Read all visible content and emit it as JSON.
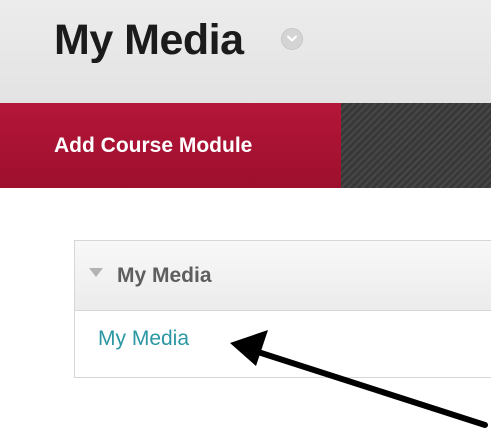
{
  "header": {
    "title": "My Media",
    "title_menu_icon": "chevron-down-icon"
  },
  "toolbar": {
    "add_module_label": "Add Course Module",
    "accent_color": "#a8122f"
  },
  "module": {
    "title": "My Media",
    "collapse_icon": "triangle-down-icon",
    "link_label": "My Media",
    "link_color": "#2a97a3"
  },
  "annotation": {
    "arrow_icon": "arrow-icon",
    "arrow_color": "#000000"
  }
}
